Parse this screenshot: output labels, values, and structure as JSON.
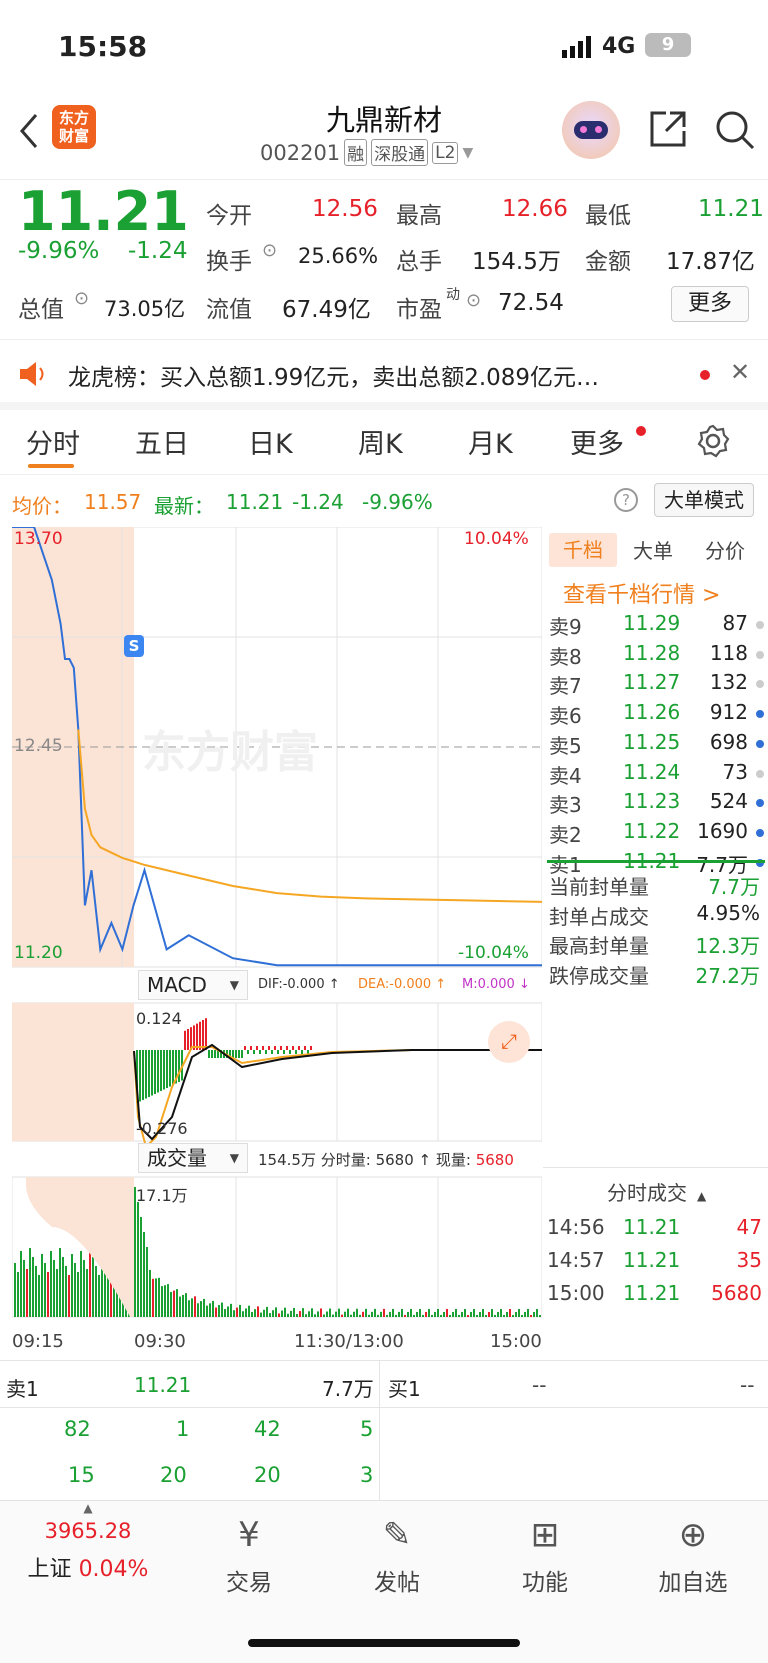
{
  "status": {
    "time": "15:58",
    "network": "4G",
    "battery": "9"
  },
  "nav": {
    "title": "九鼎新材",
    "code": "002201",
    "tags": [
      "融",
      "深股通",
      "L2"
    ],
    "logo_line1": "东方",
    "logo_line2": "财富"
  },
  "quote": {
    "price": "11.21",
    "change_pct": "-9.96%",
    "change": "-1.24",
    "open_label": "今开",
    "open": "12.56",
    "high_label": "最高",
    "high": "12.66",
    "low_label": "最低",
    "low": "11.21",
    "turnover_label": "换手",
    "turnover": "25.66%",
    "volume_label": "总手",
    "volume": "154.5万",
    "amount_label": "金额",
    "amount": "17.87亿",
    "mktcap_label": "总值",
    "mktcap": "73.05亿",
    "float_label": "流值",
    "float": "67.49亿",
    "pe_label": "市盈",
    "pe_sup": "动",
    "pe": "72.54",
    "more_label": "更多"
  },
  "banner": {
    "text": "龙虎榜：买入总额1.99亿元，卖出总额2.089亿元…"
  },
  "tabs": [
    "分时",
    "五日",
    "日K",
    "周K",
    "月K",
    "更多"
  ],
  "infoline": {
    "avg_label": "均价：",
    "avg": "11.57",
    "latest_label": "最新：",
    "latest": "11.21",
    "latest_chg": "-1.24",
    "latest_pct": "-9.96%",
    "mode_button": "大单模式"
  },
  "chart_labels": {
    "y_top": "13.70",
    "y_mid": "12.45",
    "y_bot": "11.20",
    "pct_top": "10.04%",
    "pct_bot": "-10.04%",
    "marker": "S",
    "watermark": "东方财富",
    "macd_label": "MACD",
    "dif": "DIF:-0.000 ↑",
    "dea": "DEA:-0.000 ↑",
    "m": "M:0.000 ↓",
    "macd_top": "0.124",
    "macd_bot": "-0.276",
    "vol_label": "成交量",
    "vol_total": "154.5万",
    "vol_tick_label": "分时量:",
    "vol_tick": "5680 ↑",
    "vol_now_label": "现量:",
    "vol_now": "5680",
    "vol_max": "17.1万",
    "x_ticks": [
      "09:15",
      "09:30",
      "11:30/13:00",
      "15:00"
    ]
  },
  "chart_data": {
    "type": "line",
    "title": "",
    "xlabel": "",
    "ylabel": "",
    "ylim": [
      11.2,
      13.7
    ],
    "x_ticks": [
      "09:15",
      "09:30",
      "11:30/13:00",
      "15:00"
    ],
    "series": [
      {
        "name": "最新",
        "x": [
          0,
          10,
          14,
          18,
          22,
          24,
          26,
          28,
          30,
          33,
          36,
          40,
          45,
          50,
          55,
          60,
          70,
          80,
          100,
          120,
          140,
          160,
          180,
          200,
          240
        ],
        "y": [
          13.7,
          13.7,
          13.55,
          13.4,
          13.15,
          12.95,
          12.95,
          12.9,
          12.55,
          11.55,
          11.75,
          11.3,
          11.45,
          11.3,
          11.55,
          11.75,
          11.3,
          11.38,
          11.25,
          11.21,
          11.21,
          11.21,
          11.21,
          11.21,
          11.21
        ]
      },
      {
        "name": "均价",
        "x": [
          30,
          33,
          36,
          40,
          50,
          60,
          80,
          100,
          120,
          140,
          160,
          200,
          240
        ],
        "y": [
          12.55,
          12.1,
          11.95,
          11.88,
          11.82,
          11.78,
          11.72,
          11.66,
          11.62,
          11.6,
          11.59,
          11.58,
          11.57
        ]
      }
    ]
  },
  "book": {
    "tabs": [
      "千档",
      "大单",
      "分价"
    ],
    "link": "查看千档行情 >",
    "asks": [
      {
        "label": "卖9",
        "price": "11.29",
        "qty": "87",
        "dot": "#cccccc"
      },
      {
        "label": "卖8",
        "price": "11.28",
        "qty": "118",
        "dot": "#cccccc"
      },
      {
        "label": "卖7",
        "price": "11.27",
        "qty": "132",
        "dot": "#cccccc"
      },
      {
        "label": "卖6",
        "price": "11.26",
        "qty": "912",
        "dot": "#2f6fd6"
      },
      {
        "label": "卖5",
        "price": "11.25",
        "qty": "698",
        "dot": "#2f6fd6"
      },
      {
        "label": "卖4",
        "price": "11.24",
        "qty": "73",
        "dot": "#cccccc"
      },
      {
        "label": "卖3",
        "price": "11.23",
        "qty": "524",
        "dot": "#2f6fd6"
      },
      {
        "label": "卖2",
        "price": "11.22",
        "qty": "1690",
        "dot": "#2f6fd6"
      },
      {
        "label": "卖1",
        "price": "11.21",
        "qty": "7.7万",
        "dot": "#2f6fd6"
      }
    ],
    "stats": [
      {
        "label": "当前封单量",
        "value": "7.7万",
        "color": "green"
      },
      {
        "label": "封单占成交",
        "value": "4.95%",
        "color": "black"
      },
      {
        "label": "最高封单量",
        "value": "12.3万",
        "color": "green"
      },
      {
        "label": "跌停成交量",
        "value": "27.2万",
        "color": "green"
      }
    ],
    "ticks_title": "分时成交",
    "ticks": [
      {
        "time": "14:56",
        "price": "11.21",
        "qty": "47"
      },
      {
        "time": "14:57",
        "price": "11.21",
        "qty": "35"
      },
      {
        "time": "15:00",
        "price": "11.21",
        "qty": "5680"
      }
    ]
  },
  "bottom_table": {
    "sell_label": "卖1",
    "sell_price": "11.21",
    "sell_qty": "7.7万",
    "buy_label": "买1",
    "buy_price": "--",
    "buy_qty": "--",
    "row1": [
      "82",
      "1",
      "42",
      "5"
    ],
    "row2": [
      "15",
      "20",
      "20",
      "3"
    ]
  },
  "bottom_nav": {
    "index_value": "3965.28",
    "index_name": "上证",
    "index_pct": "0.04%",
    "items": [
      {
        "label": "交易",
        "icon": "exchange-icon"
      },
      {
        "label": "发帖",
        "icon": "edit-icon"
      },
      {
        "label": "功能",
        "icon": "grid-icon"
      },
      {
        "label": "加自选",
        "icon": "plus-circle-icon"
      }
    ]
  },
  "colors": {
    "accent": "#f0801e",
    "up": "#e6212a",
    "down": "#1aa033",
    "line": "#2f6fd6",
    "avg": "#f5a623"
  }
}
